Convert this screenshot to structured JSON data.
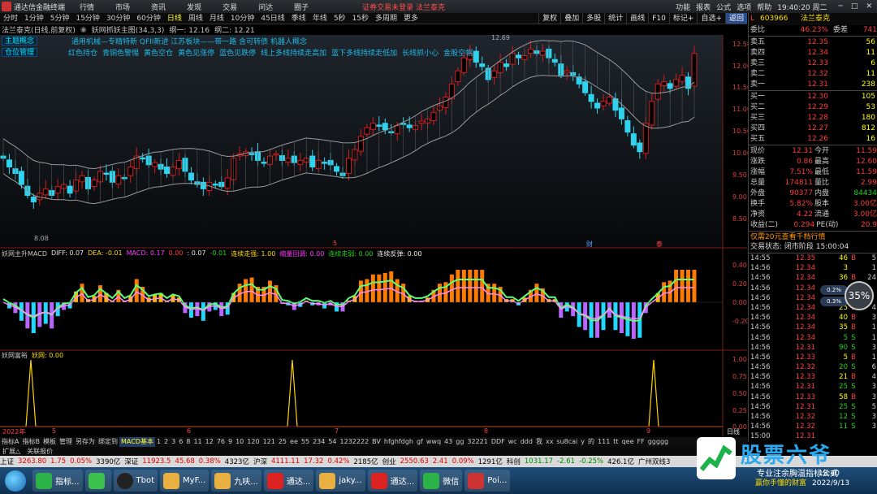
{
  "app": {
    "title": "通达信金融终端",
    "menus": [
      "行情",
      "市场",
      "资讯",
      "发现",
      "交易",
      "问达",
      "圈子"
    ],
    "notice": "证券交易未登录",
    "notice_name": "法兰泰克",
    "right_menu": [
      "功能",
      "报表",
      "公式",
      "选项",
      "帮助"
    ],
    "clock": "19:40:20 周二",
    "window_controls": [
      "─",
      "□",
      "✕"
    ]
  },
  "timeframes": [
    "分时",
    "1分钟",
    "5分钟",
    "15分钟",
    "30分钟",
    "60分钟",
    "日线",
    "周线",
    "月线",
    "10分钟",
    "45日线",
    "季线",
    "年线",
    "5秒",
    "15秒",
    "多周期",
    "更多"
  ],
  "active_timeframe": "日线",
  "toolbar_right": [
    "复权",
    "叠加",
    "多股",
    "统计",
    "画线",
    "F10",
    "标记+",
    "自选+",
    "返回"
  ],
  "chart_header": {
    "stock": "法兰泰克(日线,前复权)",
    "indicator": "妖网抓妖主图(34,3,3)",
    "v1": "纲一: 12.16",
    "v2": "纲二: 12.21"
  },
  "tags": {
    "tag1": "主题概念",
    "tag2": "仓位管理"
  },
  "ann_row1": "通用机械—专精特新 QFII新进 江苏板块——带一路 含可转债 机器人概念",
  "ann_row2": [
    "红色持仓",
    "青铜色警惕",
    "黄色空仓",
    "黄色见涨停",
    "蓝色见跌停",
    "线上多线持续走高加",
    "蓝下多线持续走低加",
    "长线抓小心",
    "金股空帽"
  ],
  "price_axis": [
    "12.50",
    "12.00",
    "11.50",
    "11.00",
    "10.50",
    "10.00",
    "9.50",
    "9.00",
    "8.50"
  ],
  "high_label": "12.69",
  "low_label": "8.08",
  "markers": {
    "m1": "5",
    "m2": "财",
    "m3": "泰"
  },
  "macd_header": {
    "name": "妖网主升MACD",
    "diff": "DIFF: 0.07",
    "dea": "DEA: -0.01",
    "macd": "MACD: 0.17",
    "v1": "0.00",
    "v2": ": 0.07",
    "v3": "-0.01",
    "lt": "连续走强: 1.00",
    "lh": "缩量回调: 0.00",
    "lg": "连续走弱: 0.00",
    "lb": "连续反弹: 0.00"
  },
  "macd_axis": [
    "0.40",
    "0.20",
    "0.00",
    "-0.20"
  ],
  "signal_header": {
    "name": "妖网富裕",
    "val": "妖网: 0.00"
  },
  "signal_axis": [
    "1.00",
    "0.75",
    "0.50",
    "0.25",
    "0.00"
  ],
  "date_axis": {
    "year": "2022年",
    "labels": [
      "5",
      "6",
      "7",
      "8",
      "9"
    ],
    "right": "日线"
  },
  "quote": {
    "code": "603966",
    "name": "法兰泰克",
    "webi": "委比",
    "webi_v": "46.23%",
    "wecha": "委差",
    "wecha_v": "741",
    "asks": [
      [
        "卖五",
        "12.35",
        "56"
      ],
      [
        "卖四",
        "12.34",
        "11"
      ],
      [
        "卖三",
        "12.33",
        "6"
      ],
      [
        "卖二",
        "12.32",
        "11"
      ],
      [
        "卖一",
        "12.31",
        "238"
      ]
    ],
    "bids": [
      [
        "买一",
        "12.30",
        "105"
      ],
      [
        "买二",
        "12.29",
        "53"
      ],
      [
        "买三",
        "12.28",
        "180"
      ],
      [
        "买四",
        "12.27",
        "812"
      ],
      [
        "买五",
        "12.26",
        "16"
      ]
    ],
    "stats": [
      [
        "现价",
        "12.31",
        "今开",
        "11.59"
      ],
      [
        "涨跌",
        "0.86",
        "最高",
        "12.60"
      ],
      [
        "涨幅",
        "7.51%",
        "最低",
        "11.59"
      ],
      [
        "总量",
        "174811",
        "量比",
        "2.99"
      ],
      [
        "外盘",
        "90377",
        "内盘",
        "84434"
      ],
      [
        "换手",
        "5.82%",
        "股本",
        "3.00亿"
      ],
      [
        "净资",
        "4.22",
        "流通",
        "3.00亿"
      ],
      [
        "收益(二)",
        "0.294",
        "PE(动)",
        "20.9"
      ]
    ],
    "promo": "仅需20元查看千档行情",
    "trade_state": "交易状态: 闭市阶段 15:00:04",
    "ticks": [
      [
        "14:55",
        "12.35",
        "46",
        "B",
        "5"
      ],
      [
        "14:56",
        "12.34",
        "3",
        "",
        "1"
      ],
      [
        "14:56",
        "12.34",
        "36",
        "B",
        "24"
      ],
      [
        "14:56",
        "12.34",
        "",
        "",
        ""
      ],
      [
        "14:56",
        "12.34",
        "",
        "",
        ""
      ],
      [
        "14:56",
        "12.34",
        "25",
        "B",
        "4"
      ],
      [
        "14:56",
        "12.34",
        "40",
        "B",
        "3"
      ],
      [
        "14:56",
        "12.34",
        "35",
        "B",
        "1"
      ],
      [
        "14:56",
        "12.34",
        "5",
        "S",
        "1"
      ],
      [
        "14:56",
        "12.31",
        "90",
        "S",
        "3"
      ],
      [
        "14:56",
        "12.33",
        "5",
        "B",
        "1"
      ],
      [
        "14:56",
        "12.32",
        "20",
        "S",
        "6"
      ],
      [
        "14:56",
        "12.33",
        "21",
        "B",
        "4"
      ],
      [
        "14:56",
        "12.31",
        "25",
        "S",
        "3"
      ],
      [
        "14:56",
        "12.33",
        "58",
        "B",
        "3"
      ],
      [
        "14:56",
        "12.31",
        "25",
        "S",
        "5"
      ],
      [
        "14:56",
        "12.32",
        "12",
        "S",
        "3"
      ],
      [
        "14:56",
        "12.32",
        "11",
        "S",
        "3"
      ],
      [
        "15:00",
        "12.31",
        "",
        "",
        ""
      ]
    ],
    "pct_up": "0.2%",
    "pct_dn": "0.3%",
    "gauge": "35%"
  },
  "bottom_tabs": [
    "指标A",
    "指标B",
    "模板",
    "管理",
    "另存为",
    "绑定到",
    "MACD基本",
    "1",
    "2",
    "3",
    "6",
    "8",
    "11",
    "12",
    "76",
    "9",
    "10",
    "120",
    "121",
    "25",
    "ee",
    "55",
    "234",
    "54",
    "1232222",
    "BV",
    "hfghfdgh",
    "gf",
    "wwq",
    "43",
    "gg",
    "32221",
    "DDF",
    "wc",
    "ddd",
    "我",
    "xx",
    "su8cai",
    "y",
    "的",
    "111",
    "tt",
    "qee",
    "FF",
    "ggggg"
  ],
  "extra_row": [
    "扩展△",
    "关联报价"
  ],
  "status": [
    {
      "t": "上证",
      "c": "k"
    },
    {
      "t": "3263.80",
      "c": "r"
    },
    {
      "t": "1.75",
      "c": "r"
    },
    {
      "t": "0.05%",
      "c": "r"
    },
    {
      "t": "3390亿",
      "c": "k"
    },
    {
      "t": "深证",
      "c": "k"
    },
    {
      "t": "11923.5",
      "c": "r"
    },
    {
      "t": "45.68",
      "c": "r"
    },
    {
      "t": "0.38%",
      "c": "r"
    },
    {
      "t": "4323亿",
      "c": "k"
    },
    {
      "t": "沪深",
      "c": "k"
    },
    {
      "t": "4111.11",
      "c": "r"
    },
    {
      "t": "17.32",
      "c": "r"
    },
    {
      "t": "0.42%",
      "c": "r"
    },
    {
      "t": "2185亿",
      "c": "k"
    },
    {
      "t": "创业",
      "c": "k"
    },
    {
      "t": "2550.63",
      "c": "r"
    },
    {
      "t": "2.41",
      "c": "r"
    },
    {
      "t": "0.09%",
      "c": "r"
    },
    {
      "t": "1291亿",
      "c": "k"
    },
    {
      "t": "科创",
      "c": "k"
    },
    {
      "t": "1031.17",
      "c": "g"
    },
    {
      "t": "-2.61",
      "c": "g"
    },
    {
      "t": "-0.25%",
      "c": "g"
    },
    {
      "t": "426.1亿",
      "c": "k"
    },
    {
      "t": "广州双线3",
      "c": "k"
    }
  ],
  "taskbar": [
    "指标...",
    "",
    "Tbot",
    "MyF...",
    "九呋...",
    "通达...",
    "jaky...",
    "通达...",
    "微信",
    "Poi..."
  ],
  "brand": {
    "title": "股票六爷",
    "subtitle": "专业注余胸温指标公式",
    "slogan": "赢你手懂的财富",
    "date": "2022/9/13",
    "time": "19:40"
  }
}
